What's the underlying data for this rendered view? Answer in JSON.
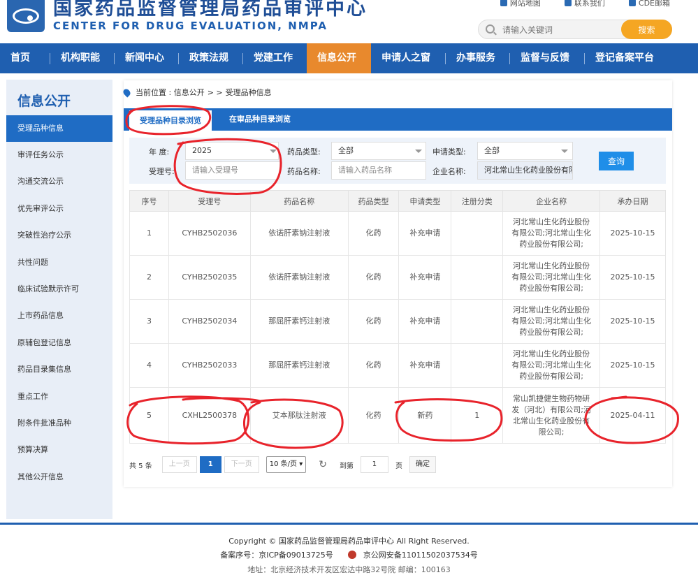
{
  "header": {
    "title_cn": "国家药品监督管理局药品审评中心",
    "title_en": "CENTER FOR DRUG EVALUATION, NMPA",
    "links": [
      "网站地图",
      "联系我们",
      "CDE邮箱"
    ],
    "search_placeholder": "请输入关键词",
    "search_button": "搜索"
  },
  "nav": [
    "首页",
    "机构职能",
    "新闻中心",
    "政策法规",
    "党建工作",
    "信息公开",
    "申请人之窗",
    "办事服务",
    "监督与反馈",
    "登记备案平台"
  ],
  "sidebar": {
    "title": "信息公开",
    "items": [
      "受理品种信息",
      "审评任务公示",
      "沟通交流公示",
      "优先审评公示",
      "突破性治疗公示",
      "共性问题",
      "临床试验默示许可",
      "上市药品信息",
      "原辅包登记信息",
      "药品目录集信息",
      "重点工作",
      "附条件批准品种",
      "预算决算",
      "其他公开信息"
    ]
  },
  "breadcrumb": {
    "prefix": "当前位置 : 信息公开",
    "sep": "> >",
    "current": "受理品种信息"
  },
  "tabs": [
    "受理品种目录浏览",
    "在审品种目录浏览"
  ],
  "filters": {
    "year_label": "年  度:",
    "year_value": "2025",
    "drug_type_label": "药品类型:",
    "drug_type_value": "全部",
    "apply_type_label": "申请类型:",
    "apply_type_value": "全部",
    "accept_no_label": "受理号:",
    "accept_no_placeholder": "请输入受理号",
    "drug_name_label": "药品名称:",
    "drug_name_placeholder": "请输入药品名称",
    "company_label": "企业名称:",
    "company_value": "河北常山生化药业股份有限公司",
    "query_button": "查询"
  },
  "table": {
    "headers": [
      "序号",
      "受理号",
      "药品名称",
      "药品类型",
      "申请类型",
      "注册分类",
      "企业名称",
      "承办日期"
    ],
    "rows": [
      [
        "1",
        "CYHB2502036",
        "依诺肝素钠注射液",
        "化药",
        "补充申请",
        "",
        "河北常山生化药业股份有限公司;河北常山生化药业股份有限公司;",
        "2025-10-15"
      ],
      [
        "2",
        "CYHB2502035",
        "依诺肝素钠注射液",
        "化药",
        "补充申请",
        "",
        "河北常山生化药业股份有限公司;河北常山生化药业股份有限公司;",
        "2025-10-15"
      ],
      [
        "3",
        "CYHB2502034",
        "那屈肝素钙注射液",
        "化药",
        "补充申请",
        "",
        "河北常山生化药业股份有限公司;河北常山生化药业股份有限公司;",
        "2025-10-15"
      ],
      [
        "4",
        "CYHB2502033",
        "那屈肝素钙注射液",
        "化药",
        "补充申请",
        "",
        "河北常山生化药业股份有限公司;河北常山生化药业股份有限公司;",
        "2025-10-15"
      ],
      [
        "5",
        "CXHL2500378",
        "艾本那肽注射液",
        "化药",
        "新药",
        "1",
        "常山凯捷健生物药物研发（河北）有限公司;河北常山生化药业股份有限公司;",
        "2025-04-11"
      ]
    ]
  },
  "pager": {
    "total": "共 5 条",
    "prev": "上一页",
    "current": "1",
    "next": "下一页",
    "page_size": "10 条/页",
    "goto": "到第",
    "goto_value": "1",
    "page_unit": "页",
    "confirm": "确定"
  },
  "footer": {
    "copyright": "Copyright © 国家药品监督管理局药品审评中心   All Right Reserved.",
    "icp": "备案序号：京ICP备09013725号",
    "police": "京公网安备11011502037534号",
    "address": "地址：北京经济技术开发区宏达中路32号院    邮编：100163"
  },
  "colors": {
    "brand_blue": "#1f5fb0",
    "active_orange": "#e8892d",
    "search_orange": "#f5a623",
    "annotation_red": "#e8232b"
  }
}
